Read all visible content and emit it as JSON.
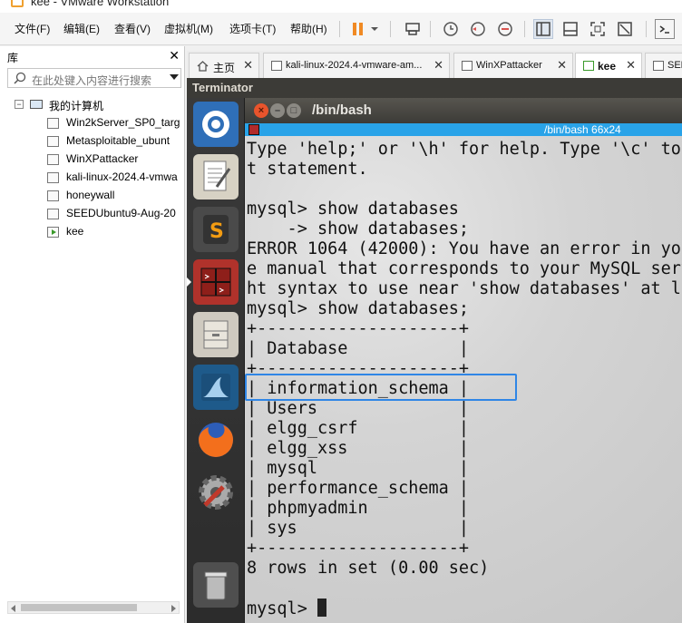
{
  "window": {
    "title": "kee - VMware Workstation"
  },
  "menu": [
    "文件(F)",
    "编辑(E)",
    "查看(V)",
    "虚拟机(M)",
    "选项卡(T)",
    "帮助(H)"
  ],
  "library": {
    "title": "库",
    "search_placeholder": "在此处键入内容进行搜索",
    "root": "我的计算机",
    "vms": [
      "Win2kServer_SP0_targ",
      "Metasploitable_ubunt",
      "WinXPattacker",
      "kali-linux-2024.4-vmwa",
      "honeywall",
      "SEEDUbuntu9-Aug-20",
      "kee"
    ],
    "running_vm_index": 6
  },
  "tabs": [
    {
      "label": "主页",
      "icon": "home-icon"
    },
    {
      "label": "kali-linux-2024.4-vmware-am...",
      "icon": "vm-icon"
    },
    {
      "label": "WinXPattacker",
      "icon": "vm-icon"
    },
    {
      "label": "kee",
      "icon": "vm-running-icon",
      "active": true
    },
    {
      "label": "SEE",
      "icon": "vm-icon"
    }
  ],
  "vm": {
    "top_app_name": "Terminator",
    "terminal": {
      "title": "/bin/bash",
      "header": "/bin/bash 66x24",
      "lines": [
        "Type 'help;' or '\\h' for help. Type '\\c' to",
        "t statement.",
        "",
        "mysql> show databases",
        "    -> show databases;",
        "ERROR 1064 (42000): You have an error in you",
        "e manual that corresponds to your MySQL serv",
        "ht syntax to use near 'show databases' at li",
        "mysql> show databases;",
        "+--------------------+",
        "| Database           |",
        "+--------------------+",
        "| information_schema |",
        "| Users              |",
        "| elgg_csrf          |",
        "| elgg_xss           |",
        "| mysql              |",
        "| performance_schema |",
        "| phpmyadmin         |",
        "| sys                |",
        "+--------------------+",
        "8 rows in set (0.00 sec)",
        "",
        "mysql> "
      ]
    }
  },
  "colors": {
    "accent": "#2f86e6",
    "terminal_header": "#29a3e8",
    "pause": "#f08a24"
  }
}
